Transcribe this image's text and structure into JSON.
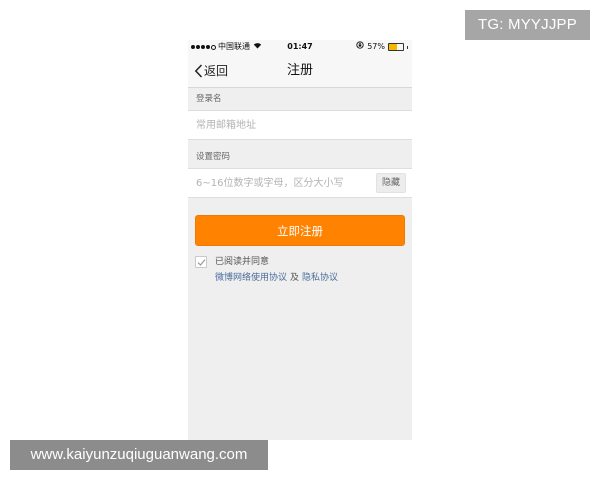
{
  "watermarks": {
    "tg": "TG: MYYJJPP",
    "site": "www.kaiyunzuqiuguanwang.com"
  },
  "status_bar": {
    "carrier": "中国联通",
    "time": "01:47",
    "battery_percent": "57%",
    "battery_level": 0.57,
    "battery_color": "#f5b800",
    "icons": [
      "signal-icon",
      "wifi-icon",
      "orientation-lock-icon",
      "battery-icon"
    ]
  },
  "nav": {
    "back_label": "返回",
    "title": "注册",
    "back_icon": "chevron-left-icon"
  },
  "form": {
    "username_label": "登录名",
    "username_placeholder": "常用邮箱地址",
    "username_value": "",
    "password_label": "设置密码",
    "password_placeholder": "6~16位数字或字母，区分大小写",
    "password_value": "",
    "hide_button": "隐藏"
  },
  "actions": {
    "register_label": "立即注册",
    "register_color": "#ff8200"
  },
  "agreement": {
    "checked": true,
    "text": "已阅读并同意",
    "link_terms": "微博网络使用协议",
    "and": "及",
    "link_privacy": "隐私协议",
    "link_color": "#4a6d9c"
  }
}
